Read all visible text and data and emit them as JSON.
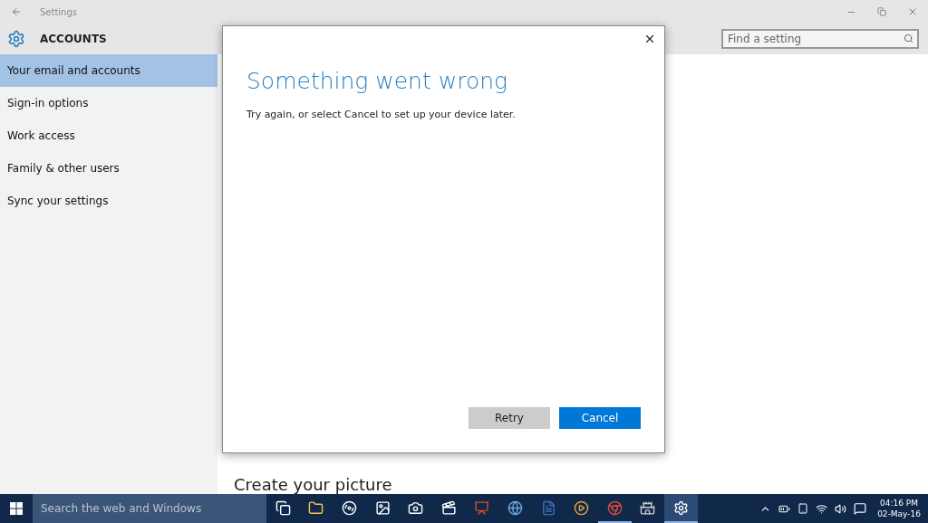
{
  "window": {
    "title": "Settings"
  },
  "header": {
    "title": "ACCOUNTS",
    "search": {
      "placeholder": "Find a setting"
    }
  },
  "sidebar": {
    "items": [
      {
        "label": "Your email and accounts",
        "selected": true
      },
      {
        "label": "Sign-in options",
        "selected": false
      },
      {
        "label": "Work access",
        "selected": false
      },
      {
        "label": "Family & other users",
        "selected": false
      },
      {
        "label": "Sync your settings",
        "selected": false
      }
    ]
  },
  "content": {
    "heading": "Create your picture"
  },
  "dialog": {
    "title": "Something went wrong",
    "message": "Try again, or select Cancel to set up your device later.",
    "buttons": [
      {
        "label": "Retry",
        "primary": false
      },
      {
        "label": "Cancel",
        "primary": true
      }
    ]
  },
  "taskbar": {
    "search": {
      "placeholder": "Search the web and Windows"
    },
    "apps": [
      {
        "kind": "taskview",
        "running": false,
        "active": false
      },
      {
        "kind": "folder",
        "running": false,
        "active": false
      },
      {
        "kind": "disc",
        "running": false,
        "active": false
      },
      {
        "kind": "photos",
        "running": false,
        "active": false
      },
      {
        "kind": "camera",
        "running": false,
        "active": false
      },
      {
        "kind": "film",
        "running": false,
        "active": false
      },
      {
        "kind": "slides",
        "running": false,
        "active": false
      },
      {
        "kind": "globe",
        "running": false,
        "active": false
      },
      {
        "kind": "doc",
        "running": false,
        "active": false
      },
      {
        "kind": "video",
        "running": false,
        "active": false
      },
      {
        "kind": "chrome",
        "running": true,
        "active": false
      },
      {
        "kind": "tower",
        "running": false,
        "active": false
      },
      {
        "kind": "gear",
        "running": true,
        "active": true
      }
    ],
    "clock": {
      "time": "04:16 PM",
      "date": "02-May-16"
    }
  }
}
